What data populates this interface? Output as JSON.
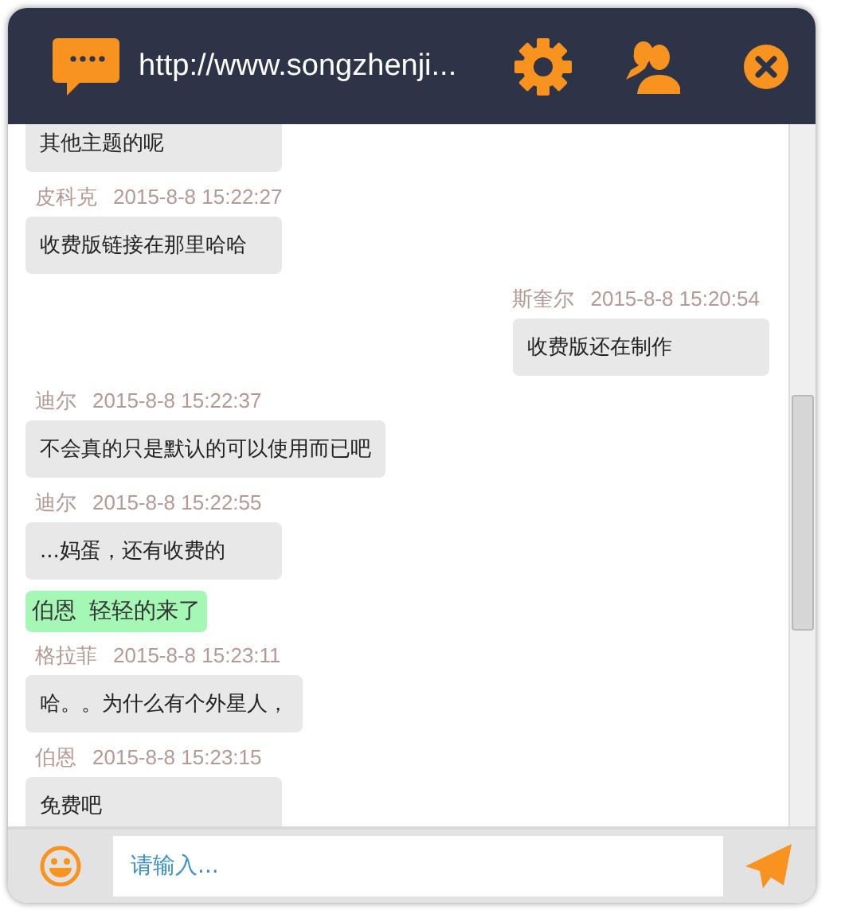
{
  "header": {
    "title": "http://www.songzhenji..."
  },
  "messages": [
    {
      "kind": "incoming",
      "text": "其他主题的呢"
    },
    {
      "kind": "incoming",
      "name": "皮科克",
      "time": "2015-8-8 15:22:27",
      "text": "收费版链接在那里哈哈"
    },
    {
      "kind": "outgoing",
      "name": "斯奎尔",
      "time": "2015-8-8 15:20:54",
      "text": "收费版还在制作"
    },
    {
      "kind": "incoming",
      "name": "迪尔",
      "time": "2015-8-8 15:22:37",
      "text": "不会真的只是默认的可以使用而已吧"
    },
    {
      "kind": "incoming",
      "name": "迪尔",
      "time": "2015-8-8 15:22:55",
      "text": "...妈蛋，还有收费的"
    },
    {
      "kind": "notice",
      "name": "伯恩",
      "text": "轻轻的来了"
    },
    {
      "kind": "incoming",
      "name": "格拉菲",
      "time": "2015-8-8 15:23:11",
      "text": "哈。。为什么有个外星人，"
    },
    {
      "kind": "incoming",
      "name": "伯恩",
      "time": "2015-8-8 15:23:15",
      "text": "免费吧"
    }
  ],
  "composer": {
    "placeholder": "请输入..."
  }
}
